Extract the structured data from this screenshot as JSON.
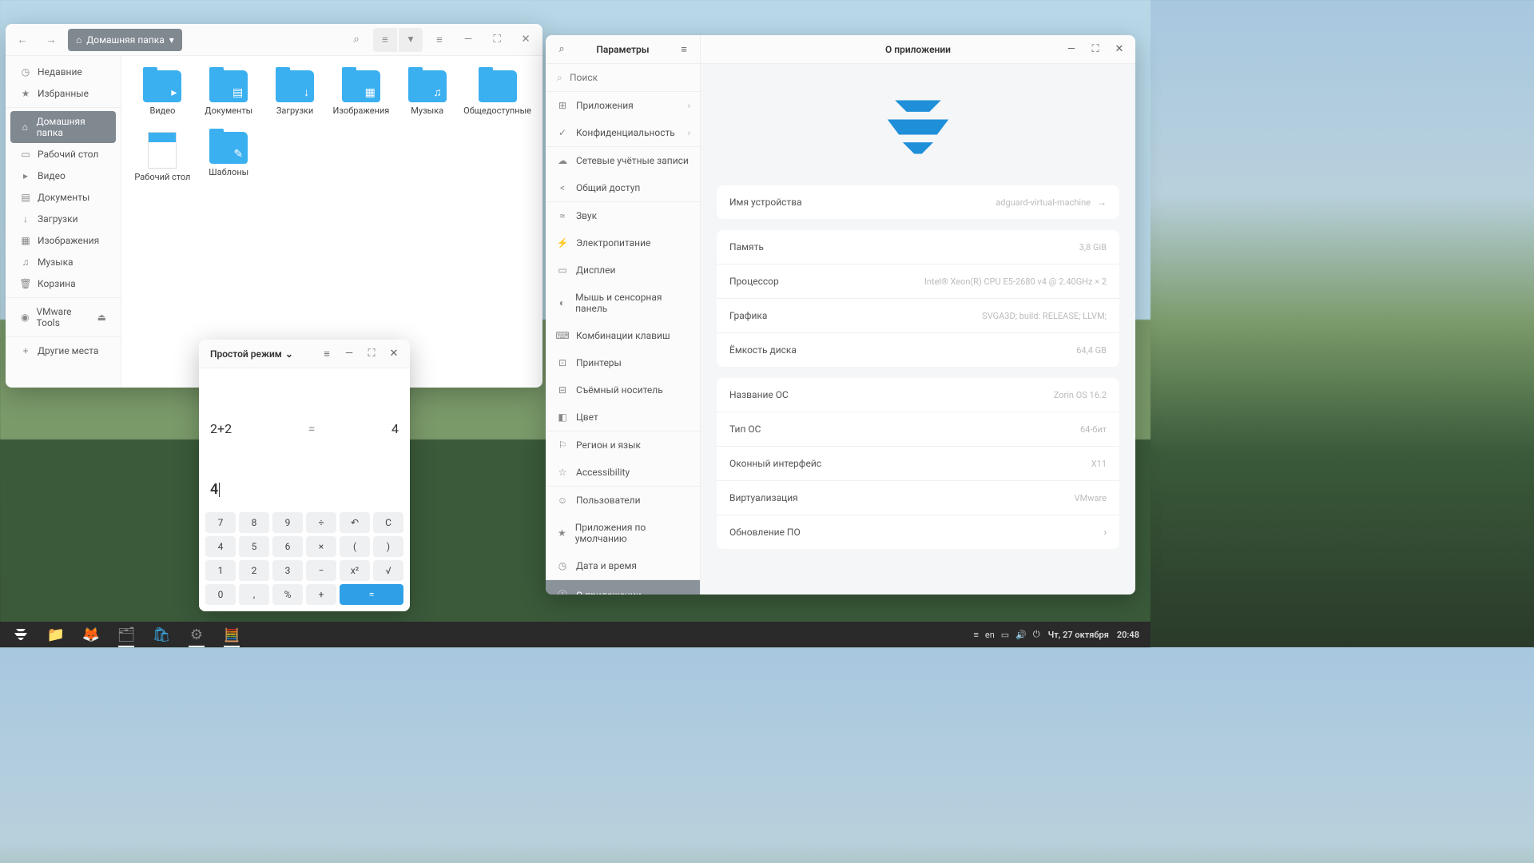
{
  "files": {
    "breadcrumb": "Домашняя папка",
    "sidebar": [
      {
        "icon": "◷",
        "label": "Недавние"
      },
      {
        "icon": "★",
        "label": "Избранные"
      },
      {
        "icon": "⌂",
        "label": "Домашняя папка",
        "active": true
      },
      {
        "icon": "▭",
        "label": "Рабочий стол"
      },
      {
        "icon": "▸",
        "label": "Видео"
      },
      {
        "icon": "▤",
        "label": "Документы"
      },
      {
        "icon": "↓",
        "label": "Загрузки"
      },
      {
        "icon": "▦",
        "label": "Изображения"
      },
      {
        "icon": "♫",
        "label": "Музыка"
      },
      {
        "icon": "🗑",
        "label": "Корзина"
      },
      {
        "icon": "◉",
        "label": "VMware Tools",
        "eject": true
      },
      {
        "icon": "+",
        "label": "Другие места"
      }
    ],
    "folders": [
      {
        "label": "Видео",
        "sub": "▸"
      },
      {
        "label": "Документы",
        "sub": "▤"
      },
      {
        "label": "Загрузки",
        "sub": "↓"
      },
      {
        "label": "Изображения",
        "sub": "▦"
      },
      {
        "label": "Музыка",
        "sub": "♫"
      },
      {
        "label": "Общедоступные",
        "sub": ""
      },
      {
        "label": "Рабочий стол",
        "sub": "",
        "file": true
      },
      {
        "label": "Шаблоны",
        "sub": "✎"
      }
    ]
  },
  "calc": {
    "mode": "Простой режим",
    "expression": "2+2",
    "eq": "=",
    "result": "4",
    "input": "4",
    "buttons": [
      "7",
      "8",
      "9",
      "÷",
      "↶",
      "C",
      "4",
      "5",
      "6",
      "×",
      "(",
      ")",
      "1",
      "2",
      "3",
      "−",
      "x²",
      "√",
      "0",
      ",",
      "%",
      "+",
      "=",
      "="
    ]
  },
  "settings": {
    "title_left": "Параметры",
    "title_right": "О приложении",
    "search_placeholder": "Поиск",
    "sidebar": [
      {
        "icon": "⊞",
        "label": "Приложения",
        "chev": true
      },
      {
        "icon": "✓",
        "label": "Конфиденциальность",
        "chev": true
      },
      {
        "icon": "☁",
        "label": "Сетевые учётные записи"
      },
      {
        "icon": "<",
        "label": "Общий доступ"
      },
      {
        "icon": "≈",
        "label": "Звук"
      },
      {
        "icon": "⚡",
        "label": "Электропитание"
      },
      {
        "icon": "▭",
        "label": "Дисплеи"
      },
      {
        "icon": "◐",
        "label": "Мышь и сенсорная панель"
      },
      {
        "icon": "⌨",
        "label": "Комбинации клавиш"
      },
      {
        "icon": "⊡",
        "label": "Принтеры"
      },
      {
        "icon": "⊟",
        "label": "Съёмный носитель"
      },
      {
        "icon": "◧",
        "label": "Цвет"
      },
      {
        "icon": "⚐",
        "label": "Регион и язык"
      },
      {
        "icon": "☆",
        "label": "Accessibility"
      },
      {
        "icon": "☺",
        "label": "Пользователи"
      },
      {
        "icon": "★",
        "label": "Приложения по умолчанию"
      },
      {
        "icon": "◷",
        "label": "Дата и время"
      },
      {
        "icon": "ⓘ",
        "label": "О приложении",
        "active": true
      }
    ],
    "device_name": {
      "label": "Имя устройства",
      "value": "adguard-virtual-machine"
    },
    "specs": [
      {
        "label": "Память",
        "value": "3,8 GiB"
      },
      {
        "label": "Процессор",
        "value": "Intel® Xeon(R) CPU E5-2680 v4 @ 2.40GHz × 2"
      },
      {
        "label": "Графика",
        "value": "SVGA3D; build: RELEASE; LLVM;"
      },
      {
        "label": "Ёмкость диска",
        "value": "64,4 GB"
      }
    ],
    "os": [
      {
        "label": "Название ОС",
        "value": "Zorin OS 16.2"
      },
      {
        "label": "Тип ОС",
        "value": "64-бит"
      },
      {
        "label": "Оконный интерфейс",
        "value": "X11"
      },
      {
        "label": "Виртуализация",
        "value": "VMware"
      },
      {
        "label": "Обновление ПО",
        "value": "",
        "chev": true
      }
    ]
  },
  "taskbar": {
    "lang": "en",
    "date": "Чт, 27 октября",
    "time": "20:48"
  }
}
